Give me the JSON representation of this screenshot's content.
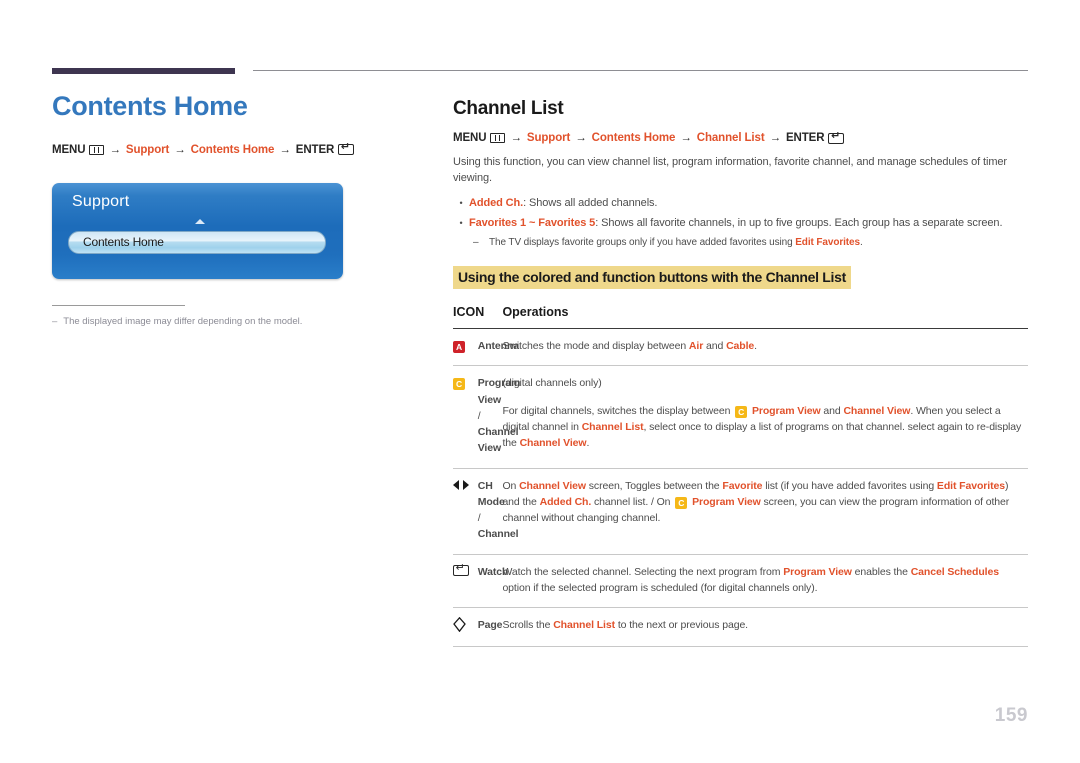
{
  "page": {
    "number": "159",
    "title": "Contents Home"
  },
  "left": {
    "menu_path": {
      "menu_label": "MENU",
      "menu_icon": "menu-grid-icon",
      "arrow": "→",
      "steps": [
        "Support",
        "Contents Home"
      ],
      "enter_label": "ENTER",
      "enter_icon": "enter-key-icon"
    },
    "tv_mock": {
      "title": "Support",
      "caret_icon": "caret-up-icon",
      "selected_item": "Contents Home"
    },
    "note": {
      "dash": "–",
      "text": "The displayed image may differ depending on the model."
    }
  },
  "right": {
    "section_title": "Channel List",
    "menu_path": {
      "menu_label": "MENU",
      "menu_icon": "menu-grid-icon",
      "arrow": "→",
      "steps": [
        "Support",
        "Contents Home",
        "Channel List"
      ],
      "enter_label": "ENTER",
      "enter_icon": "enter-key-icon"
    },
    "intro": "Using this function, you can view channel list, program information, favorite channel, and manage schedules of timer viewing.",
    "bullets": [
      {
        "dot": "•",
        "term": "Added Ch.",
        "rest": ": Shows all added channels."
      },
      {
        "dot": "•",
        "term": "Favorites 1 ~ Favorites 5",
        "rest": ": Shows all favorite channels, in up to five groups. Each group has a separate screen."
      }
    ],
    "subnote": {
      "dash": "–",
      "text_before": "The TV displays favorite groups only if you have added favorites using ",
      "term": "Edit Favorites",
      "text_after": "."
    },
    "subheading": "Using the colored and function buttons with the Channel List",
    "table": {
      "headers": [
        "ICON",
        "Operations"
      ],
      "rows": [
        {
          "icon": "badge-a-icon",
          "icon_label": "A",
          "name": "Antenna",
          "paragraphs": [
            [
              {
                "t": "Switches the mode and display between "
              },
              {
                "t": "Air",
                "b": true
              },
              {
                "t": " and "
              },
              {
                "t": "Cable",
                "b": true
              },
              {
                "t": "."
              }
            ]
          ]
        },
        {
          "icon": "badge-c-icon",
          "icon_label": "C",
          "name": "Program View / Channel View",
          "paragraphs": [
            [
              {
                "t": "(digital channels only)"
              }
            ],
            [
              {
                "t": "For digital channels, switches the display between "
              },
              {
                "badge": "C"
              },
              {
                "t": " Program View",
                "b": true
              },
              {
                "t": " and "
              },
              {
                "t": "Channel View",
                "b": true
              },
              {
                "t": ". When you select a digital channel in "
              },
              {
                "t": "Channel List",
                "b": true
              },
              {
                "t": ", select once to display a list of programs on that channel. select again to re-display the "
              },
              {
                "t": "Channel View",
                "b": true
              },
              {
                "t": "."
              }
            ]
          ]
        },
        {
          "icon": "left-right-arrows-icon",
          "icon_label": "",
          "name": "CH Mode / Channel",
          "paragraphs": [
            [
              {
                "t": "On "
              },
              {
                "t": "Channel View",
                "b": true
              },
              {
                "t": " screen, Toggles between the "
              },
              {
                "t": "Favorite",
                "b": true
              },
              {
                "t": " list (if you have added favorites using "
              },
              {
                "t": "Edit Favorites",
                "b": true
              },
              {
                "t": ") and the "
              },
              {
                "t": "Added Ch.",
                "b": true
              },
              {
                "t": " channel list. / On "
              },
              {
                "badge": "C"
              },
              {
                "t": " Program View",
                "b": true
              },
              {
                "t": " screen, you can view the program information of other channel without changing channel."
              }
            ]
          ]
        },
        {
          "icon": "enter-key-icon",
          "icon_label": "",
          "name": "Watch",
          "paragraphs": [
            [
              {
                "t": "Watch the selected channel. Selecting the next program from "
              },
              {
                "t": "Program View",
                "b": true
              },
              {
                "t": " enables the "
              },
              {
                "t": "Cancel Schedules",
                "b": true
              },
              {
                "t": " option if the selected program is scheduled (for digital channels only)."
              }
            ]
          ]
        },
        {
          "icon": "page-updown-icon",
          "icon_label": "",
          "name": "Page",
          "paragraphs": [
            [
              {
                "t": "Scrolls the "
              },
              {
                "t": "Channel List",
                "b": true
              },
              {
                "t": " to the next or previous page."
              }
            ]
          ]
        }
      ]
    }
  },
  "colors": {
    "accent_orange": "#e1522c",
    "title_blue": "#3478bd",
    "highlight_yellow": "#efd88b",
    "badge_red": "#cf2229",
    "badge_yellow": "#f5b818",
    "rule_dark": "#3e3550"
  }
}
